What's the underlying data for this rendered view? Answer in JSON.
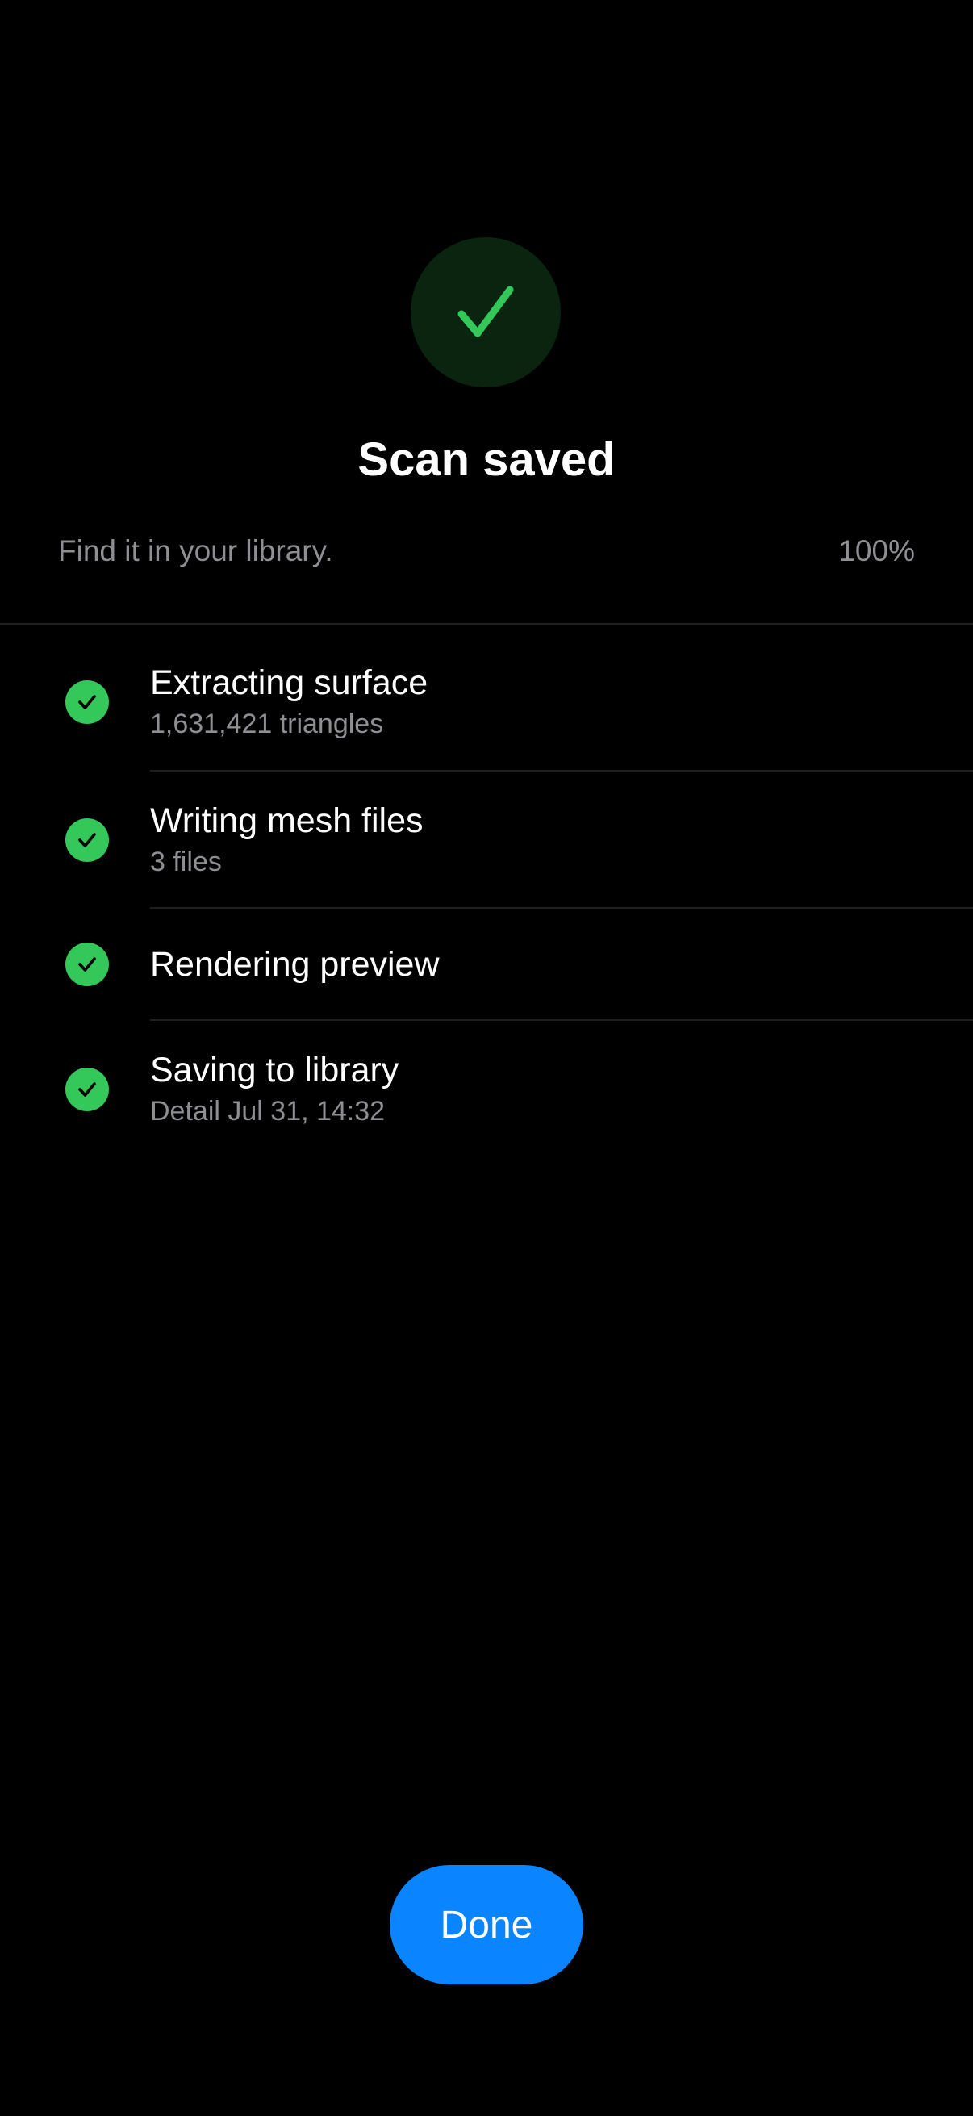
{
  "header": {
    "icon": "checkmark-icon",
    "title": "Scan saved",
    "subtitle": "Find it in your library.",
    "progress_text": "100%",
    "progress": 1.0
  },
  "steps": [
    {
      "label": "Extracting surface",
      "detail": "1,631,421 triangles",
      "status": "done",
      "icon": "checkmark-circle-icon"
    },
    {
      "label": "Writing mesh files",
      "detail": "3 files",
      "status": "done",
      "icon": "checkmark-circle-icon"
    },
    {
      "label": "Rendering preview",
      "detail": "",
      "status": "done",
      "icon": "checkmark-circle-icon"
    },
    {
      "label": "Saving to library",
      "detail": "Detail Jul 31, 14:32",
      "status": "done",
      "icon": "checkmark-circle-icon"
    }
  ],
  "actions": {
    "done_label": "Done"
  },
  "colors": {
    "background": "#000000",
    "success": "#34c759",
    "success_bg": "#0a2410",
    "accent": "#0a84ff",
    "secondary_text": "#8e8e93"
  }
}
